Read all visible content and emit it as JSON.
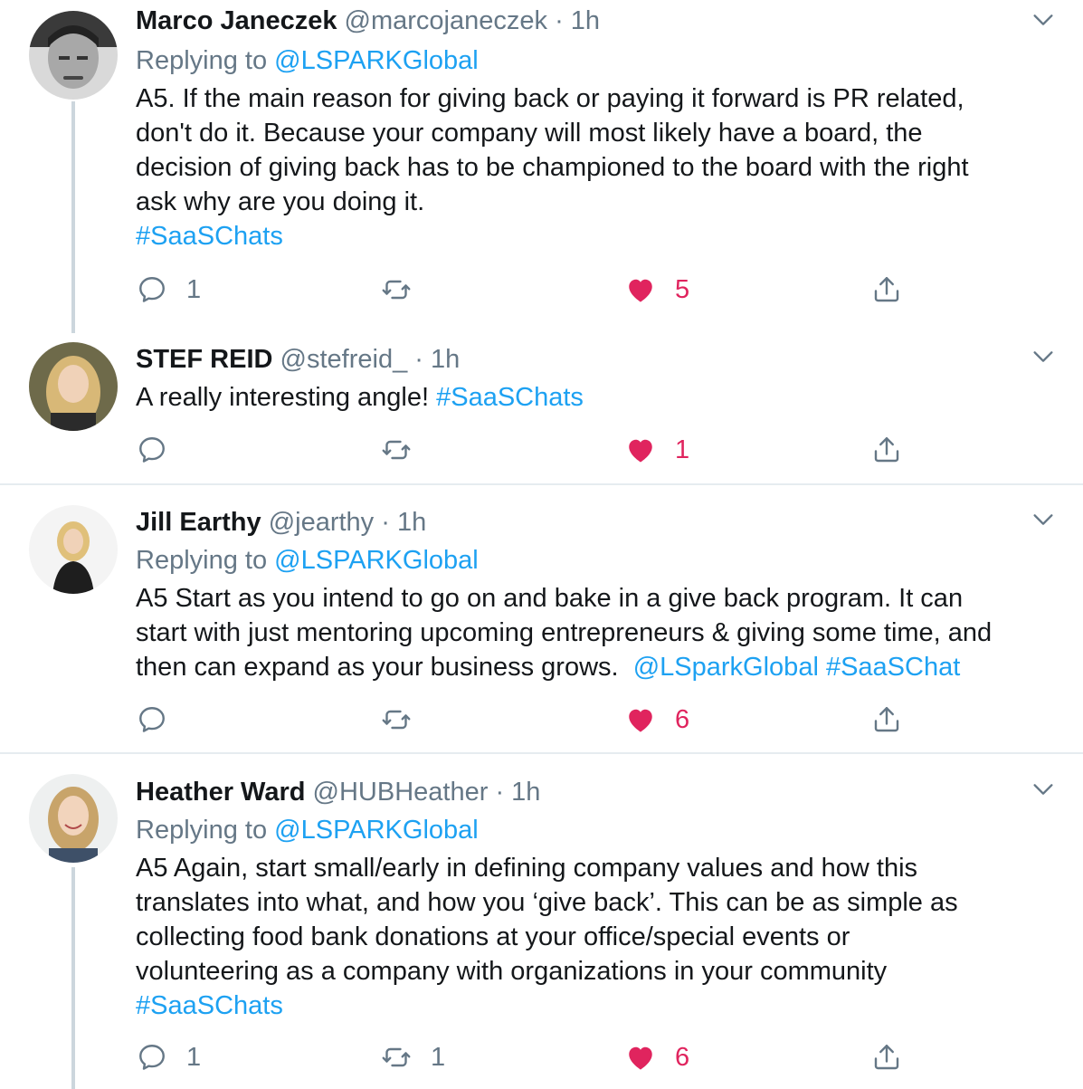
{
  "tweets": [
    {
      "name": "Marco Janeczek",
      "handle": "@marcojaneczek",
      "time": "1h",
      "replying_label": "Replying to",
      "replying_to": "@LSPARKGlobal",
      "text_lines": [
        "A5. If the main reason for giving back or paying it forward is PR related,",
        "don't do it. Because your company will most likely have a board, the",
        "decision of giving back has to be championed to the board with the right",
        "ask why are you doing it."
      ],
      "hashtag_line": "#SaaSChats",
      "replies": "1",
      "retweets": "",
      "likes": "5"
    },
    {
      "name": "STEF REID",
      "handle": "@stefreid_",
      "time": "1h",
      "text": "A really interesting angle!",
      "hashtag": "#SaaSChats",
      "replies": "",
      "retweets": "",
      "likes": "1"
    },
    {
      "name": "Jill Earthy",
      "handle": "@jearthy",
      "time": "1h",
      "replying_label": "Replying to",
      "replying_to": "@LSPARKGlobal",
      "text_lines": [
        "A5 Start as you intend to go on and bake in a give back program. It can",
        "start with just mentoring upcoming entrepreneurs & giving some time, and",
        "then can expand as your business grows."
      ],
      "mention": "@LSparkGlobal",
      "hashtag": "#SaaSChat",
      "replies": "",
      "retweets": "",
      "likes": "6"
    },
    {
      "name": "Heather Ward",
      "handle": "@HUBHeather",
      "time": "1h",
      "replying_label": "Replying to",
      "replying_to": "@LSPARKGlobal",
      "text_lines": [
        "A5 Again, start small/early in defining company values and how this",
        "translates into what, and how you ‘give back’. This can be as simple as",
        "collecting food bank donations at your office/special events or",
        "volunteering as a company with organizations in your community"
      ],
      "hashtag_line": "#SaaSChats",
      "replies": "1",
      "retweets": "1",
      "likes": "6"
    }
  ],
  "dot": "·",
  "colors": {
    "link": "#1da1f2",
    "like": "#e0245e",
    "muted": "#657786",
    "thread_line": "#ccd6dd"
  },
  "icons": [
    "reply-icon",
    "retweet-icon",
    "like-icon",
    "share-icon",
    "chevron-down-icon"
  ]
}
